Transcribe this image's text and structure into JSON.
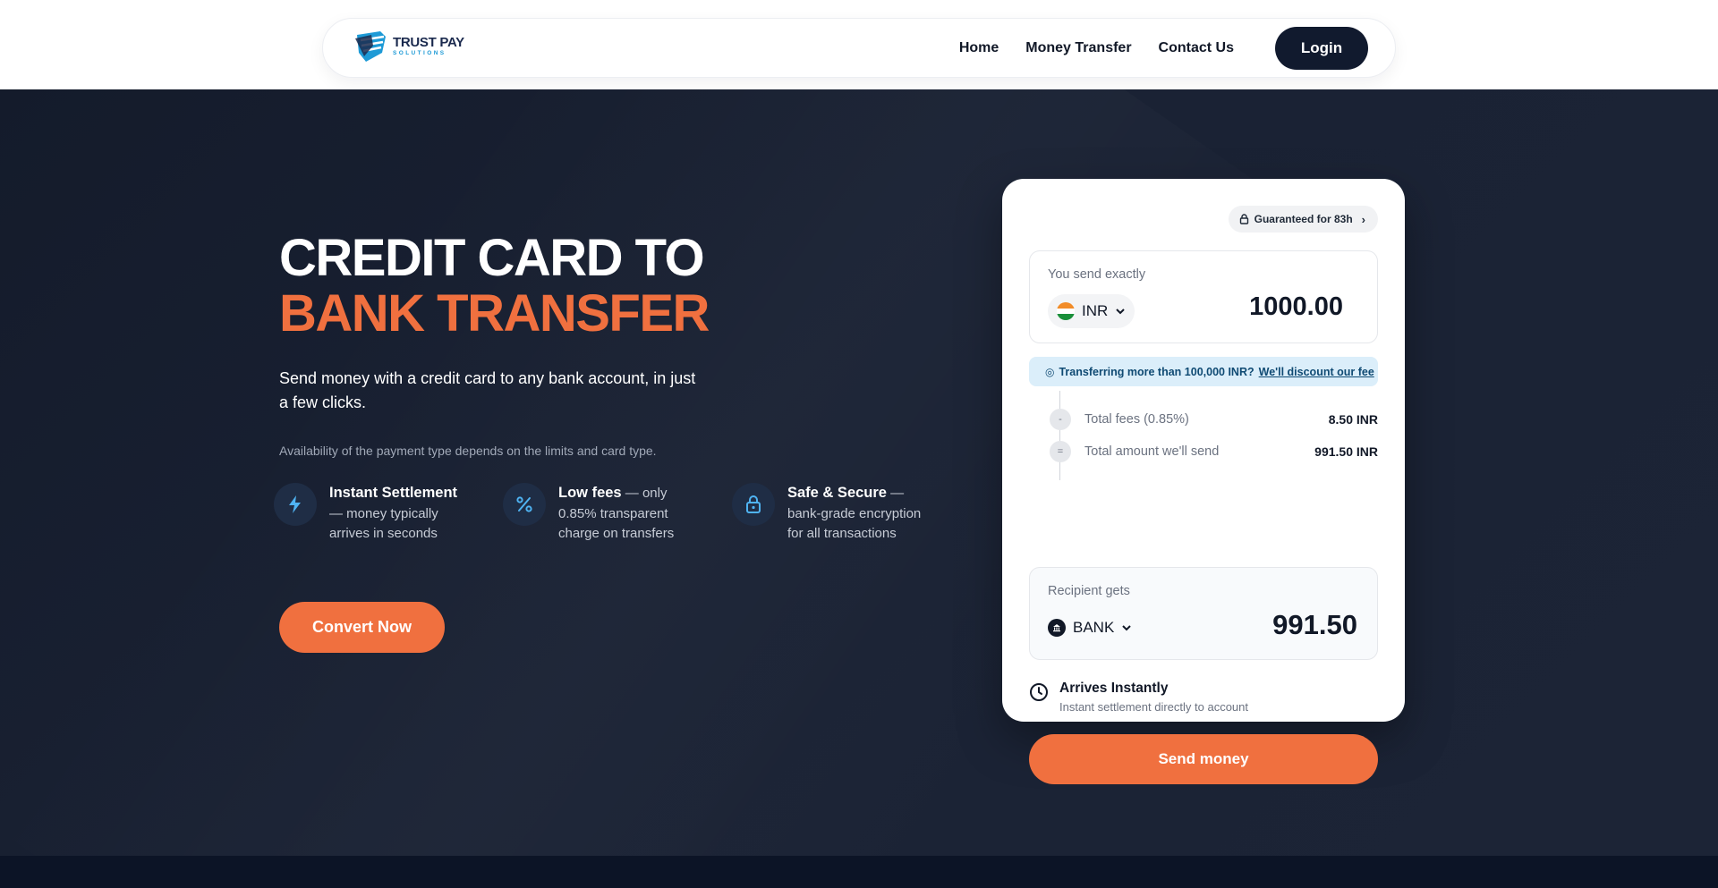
{
  "header": {
    "logo_title": "TRUST PAY",
    "logo_subtitle": "SOLUTIONS",
    "nav": [
      "Home",
      "Money Transfer",
      "Contact Us"
    ],
    "login_label": "Login"
  },
  "hero": {
    "headline_line1": "CREDIT CARD TO",
    "headline_line2": "BANK TRANSFER",
    "lede": "Send money with a credit card to any bank account, in just a few clicks.",
    "availability_note": "Availability of the payment type depends on the limits and card type.",
    "features": [
      {
        "icon": "lightning-icon",
        "title": "Instant Settlement",
        "text": "money typically arrives in seconds"
      },
      {
        "icon": "percent-icon",
        "title": "Low fees",
        "text": "only 0.85% transparent charge on transfers"
      },
      {
        "icon": "lock-icon",
        "title": "Safe & Secure",
        "text": "bank-grade encryption for all transactions"
      }
    ],
    "cta_label": "Convert Now"
  },
  "converter": {
    "guarantee_label": "Guaranteed for 83h",
    "send_label": "You send exactly",
    "send_currency": "INR",
    "send_amount": "1000.00",
    "promo_text": "Transferring more than 100,000 INR?",
    "promo_link": "We'll discount our fee",
    "fees": [
      {
        "symbol": "-",
        "label": "Total fees (0.85%)",
        "value": "8.50 INR"
      },
      {
        "symbol": "=",
        "label": "Total amount we'll send",
        "value": "991.50 INR"
      }
    ],
    "recipient_label": "Recipient gets",
    "recipient_currency": "BANK",
    "recipient_amount": "991.50",
    "arrives_title": "Arrives Instantly",
    "arrives_sub": "Instant settlement directly to account",
    "send_button": "Send money"
  },
  "colors": {
    "accent": "#f0703f",
    "navy": "#111a2e",
    "hero_bg": "#1a2234",
    "promo_bg": "#dbeefa"
  }
}
